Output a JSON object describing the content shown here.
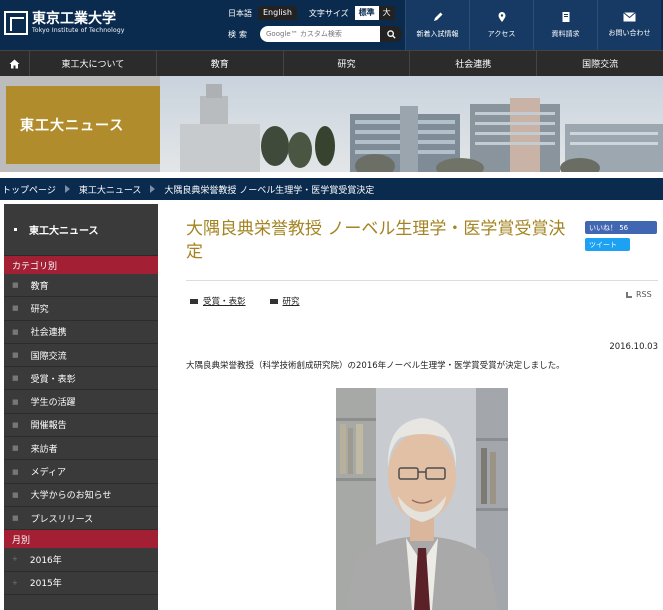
{
  "header": {
    "logo_jp": "東京工業大学",
    "logo_en": "Tokyo Institute of Technology",
    "lang_jp": "日本語",
    "lang_en": "English",
    "textsize_label": "文字サイズ",
    "textsize_standard": "標準",
    "textsize_large": "大",
    "search_label": "検索",
    "search_placeholder": "Google™ カスタム検索",
    "quick_links": [
      {
        "label": "新着入試情報",
        "icon": "pencil-icon"
      },
      {
        "label": "アクセス",
        "icon": "map-pin-icon"
      },
      {
        "label": "資料請求",
        "icon": "document-icon"
      },
      {
        "label": "お問い合わせ",
        "icon": "mail-icon"
      }
    ]
  },
  "nav": {
    "items": [
      "東工大について",
      "教育",
      "研究",
      "社会連携",
      "国際交流"
    ]
  },
  "banner": {
    "title": "東工大ニュース"
  },
  "breadcrumb": [
    "トップページ",
    "東工大ニュース",
    "大隅良典栄誉教授 ノーベル生理学・医学賞受賞決定"
  ],
  "sidebar": {
    "heading": "東工大ニュース",
    "category_label": "カテゴリ別",
    "categories": [
      "教育",
      "研究",
      "社会連携",
      "国際交流",
      "受賞・表彰",
      "学生の活躍",
      "開催報告",
      "来訪者",
      "メディア",
      "大学からのお知らせ",
      "プレスリリース"
    ],
    "month_label": "月別",
    "months": [
      "2016年",
      "2015年"
    ]
  },
  "article": {
    "title": "大隅良典栄誉教授 ノーベル生理学・医学賞受賞決定",
    "like_label": "いいね！ 56",
    "tweet_label": "ツイート",
    "tags": [
      "受賞・表彰",
      "研究"
    ],
    "rss_label": "RSS",
    "date": "2016.10.03",
    "lead": "大隅良典栄誉教授（科学技術創成研究院）の2016年ノーベル生理学・医学賞受賞が決定しました。"
  },
  "colors": {
    "navy": "#0a2a4e",
    "gold": "#b08c2c",
    "title_gold": "#a48422",
    "category_red": "#a31f34"
  }
}
